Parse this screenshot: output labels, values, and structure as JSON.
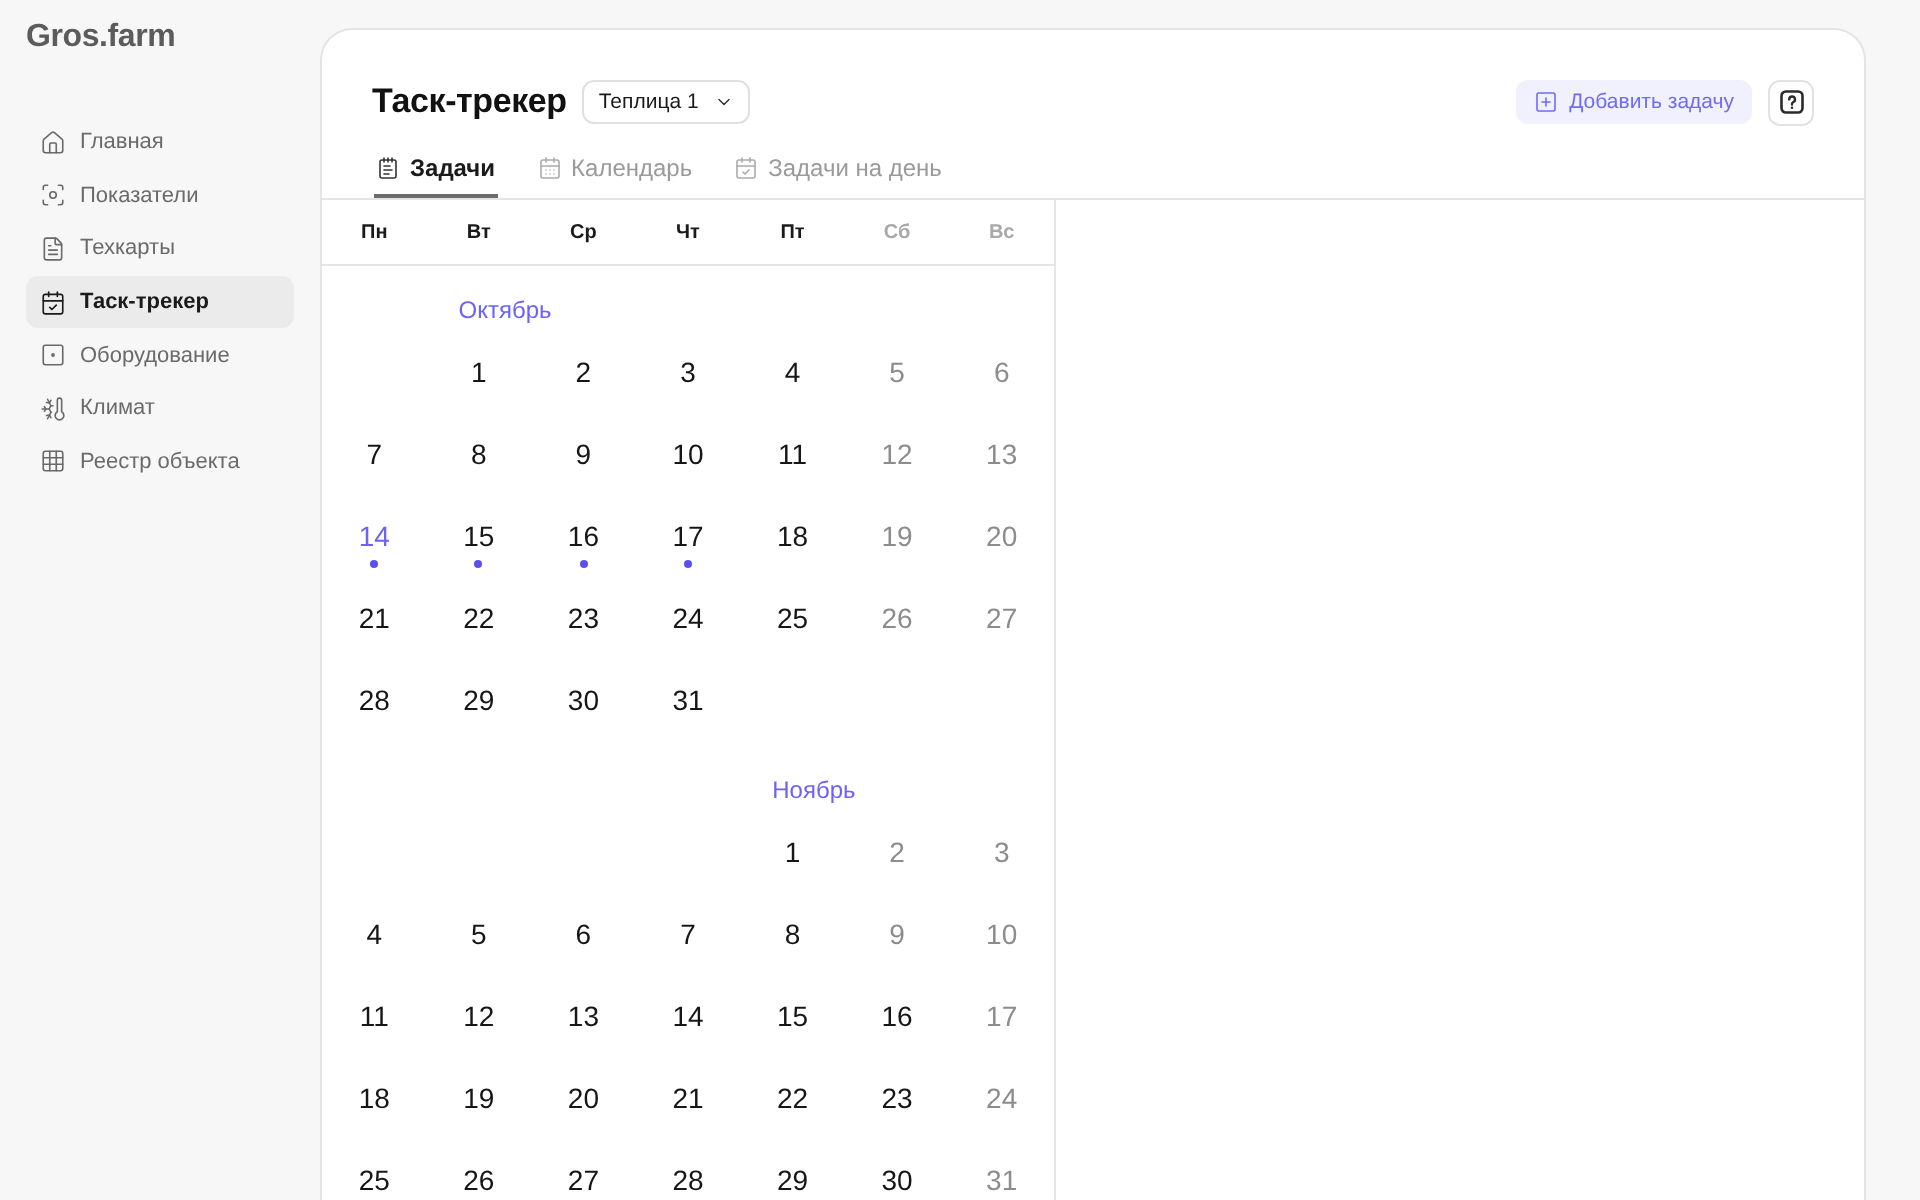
{
  "sidebar": {
    "logo": "Gros.farm",
    "items": [
      {
        "label": "Главная",
        "selected": false
      },
      {
        "label": "Показатели",
        "selected": false
      },
      {
        "label": "Техкарты",
        "selected": false
      },
      {
        "label": "Таск-трекер",
        "selected": true
      },
      {
        "label": "Оборудование",
        "selected": false
      },
      {
        "label": "Климат",
        "selected": false
      },
      {
        "label": "Реестр объекта",
        "selected": false
      }
    ]
  },
  "header": {
    "title": "Таск-трекер",
    "greenhouse_select": {
      "value": "Теплица 1"
    },
    "add_button": "Добавить задачу"
  },
  "tabs": [
    {
      "label": "Задачи",
      "selected": true
    },
    {
      "label": "Календарь",
      "selected": false
    },
    {
      "label": "Задачи на день",
      "selected": false
    }
  ],
  "calendar": {
    "weekdays": [
      {
        "label": "Пн",
        "dimmed": false
      },
      {
        "label": "Вт",
        "dimmed": false
      },
      {
        "label": "Ср",
        "dimmed": false
      },
      {
        "label": "Чт",
        "dimmed": false
      },
      {
        "label": "Пт",
        "dimmed": false
      },
      {
        "label": "Сб",
        "dimmed": true
      },
      {
        "label": "Вс",
        "dimmed": true
      }
    ],
    "months": [
      {
        "name": "Октябрь",
        "weeks": [
          [
            {
              "day": "1",
              "dimmed": false,
              "today": false,
              "has_tasks": false
            },
            {
              "day": "2",
              "dimmed": false,
              "today": false,
              "has_tasks": false
            },
            {
              "day": "3",
              "dimmed": false,
              "today": false,
              "has_tasks": false
            },
            {
              "day": "4",
              "dimmed": false,
              "today": false,
              "has_tasks": false
            },
            {
              "day": "5",
              "dimmed": true,
              "today": false,
              "has_tasks": false
            },
            {
              "day": "6",
              "dimmed": true,
              "today": false,
              "has_tasks": false
            }
          ],
          [
            {
              "day": "7",
              "dimmed": false,
              "today": false,
              "has_tasks": false
            },
            {
              "day": "8",
              "dimmed": false,
              "today": false,
              "has_tasks": false
            },
            {
              "day": "9",
              "dimmed": false,
              "today": false,
              "has_tasks": false
            },
            {
              "day": "10",
              "dimmed": false,
              "today": false,
              "has_tasks": false
            },
            {
              "day": "11",
              "dimmed": false,
              "today": false,
              "has_tasks": false
            },
            {
              "day": "12",
              "dimmed": true,
              "today": false,
              "has_tasks": false
            },
            {
              "day": "13",
              "dimmed": true,
              "today": false,
              "has_tasks": false
            }
          ],
          [
            {
              "day": "14",
              "dimmed": false,
              "today": true,
              "has_tasks": true
            },
            {
              "day": "15",
              "dimmed": false,
              "today": false,
              "has_tasks": true
            },
            {
              "day": "16",
              "dimmed": false,
              "today": false,
              "has_tasks": true
            },
            {
              "day": "17",
              "dimmed": false,
              "today": false,
              "has_tasks": true
            },
            {
              "day": "18",
              "dimmed": false,
              "today": false,
              "has_tasks": false
            },
            {
              "day": "19",
              "dimmed": true,
              "today": false,
              "has_tasks": false
            },
            {
              "day": "20",
              "dimmed": true,
              "today": false,
              "has_tasks": false
            }
          ],
          [
            {
              "day": "21",
              "dimmed": false,
              "today": false,
              "has_tasks": false
            },
            {
              "day": "22",
              "dimmed": false,
              "today": false,
              "has_tasks": false
            },
            {
              "day": "23",
              "dimmed": false,
              "today": false,
              "has_tasks": false
            },
            {
              "day": "24",
              "dimmed": false,
              "today": false,
              "has_tasks": false
            },
            {
              "day": "25",
              "dimmed": false,
              "today": false,
              "has_tasks": false
            },
            {
              "day": "26",
              "dimmed": true,
              "today": false,
              "has_tasks": false
            },
            {
              "day": "27",
              "dimmed": true,
              "today": false,
              "has_tasks": false
            }
          ],
          [
            {
              "day": "28",
              "dimmed": false,
              "today": false,
              "has_tasks": false
            },
            {
              "day": "29",
              "dimmed": false,
              "today": false,
              "has_tasks": false
            },
            {
              "day": "30",
              "dimmed": false,
              "today": false,
              "has_tasks": false
            },
            {
              "day": "31",
              "dimmed": false,
              "today": false,
              "has_tasks": false
            }
          ]
        ]
      },
      {
        "name": "Ноябрь",
        "weeks": [
          [
            {
              "day": "1",
              "dimmed": false,
              "today": false,
              "has_tasks": false
            },
            {
              "day": "2",
              "dimmed": true,
              "today": false,
              "has_tasks": false
            },
            {
              "day": "3",
              "dimmed": true,
              "today": false,
              "has_tasks": false
            }
          ],
          [
            {
              "day": "4",
              "dimmed": false,
              "today": false,
              "has_tasks": false
            },
            {
              "day": "5",
              "dimmed": false,
              "today": false,
              "has_tasks": false
            },
            {
              "day": "6",
              "dimmed": false,
              "today": false,
              "has_tasks": false
            },
            {
              "day": "7",
              "dimmed": false,
              "today": false,
              "has_tasks": false
            },
            {
              "day": "8",
              "dimmed": false,
              "today": false,
              "has_tasks": false
            },
            {
              "day": "9",
              "dimmed": true,
              "today": false,
              "has_tasks": false
            },
            {
              "day": "10",
              "dimmed": true,
              "today": false,
              "has_tasks": false
            }
          ],
          [
            {
              "day": "11",
              "dimmed": false,
              "today": false,
              "has_tasks": false
            },
            {
              "day": "12",
              "dimmed": false,
              "today": false,
              "has_tasks": false
            },
            {
              "day": "13",
              "dimmed": false,
              "today": false,
              "has_tasks": false
            },
            {
              "day": "14",
              "dimmed": false,
              "today": false,
              "has_tasks": false
            },
            {
              "day": "15",
              "dimmed": false,
              "today": false,
              "has_tasks": false
            },
            {
              "day": "16",
              "dimmed": false,
              "today": false,
              "has_tasks": false
            },
            {
              "day": "17",
              "dimmed": true,
              "today": false,
              "has_tasks": false
            }
          ],
          [
            {
              "day": "18",
              "dimmed": false,
              "today": false,
              "has_tasks": false
            },
            {
              "day": "19",
              "dimmed": false,
              "today": false,
              "has_tasks": false
            },
            {
              "day": "20",
              "dimmed": false,
              "today": false,
              "has_tasks": false
            },
            {
              "day": "21",
              "dimmed": false,
              "today": false,
              "has_tasks": false
            },
            {
              "day": "22",
              "dimmed": false,
              "today": false,
              "has_tasks": false
            },
            {
              "day": "23",
              "dimmed": false,
              "today": false,
              "has_tasks": false
            },
            {
              "day": "24",
              "dimmed": true,
              "today": false,
              "has_tasks": false
            }
          ],
          [
            {
              "day": "25",
              "dimmed": false,
              "today": false,
              "has_tasks": false
            },
            {
              "day": "26",
              "dimmed": false,
              "today": false,
              "has_tasks": false
            },
            {
              "day": "27",
              "dimmed": false,
              "today": false,
              "has_tasks": false
            },
            {
              "day": "28",
              "dimmed": false,
              "today": false,
              "has_tasks": false
            },
            {
              "day": "29",
              "dimmed": false,
              "today": false,
              "has_tasks": false
            },
            {
              "day": "30",
              "dimmed": false,
              "today": false,
              "has_tasks": false
            },
            {
              "day": "31",
              "dimmed": true,
              "today": false,
              "has_tasks": false
            }
          ]
        ]
      }
    ]
  }
}
